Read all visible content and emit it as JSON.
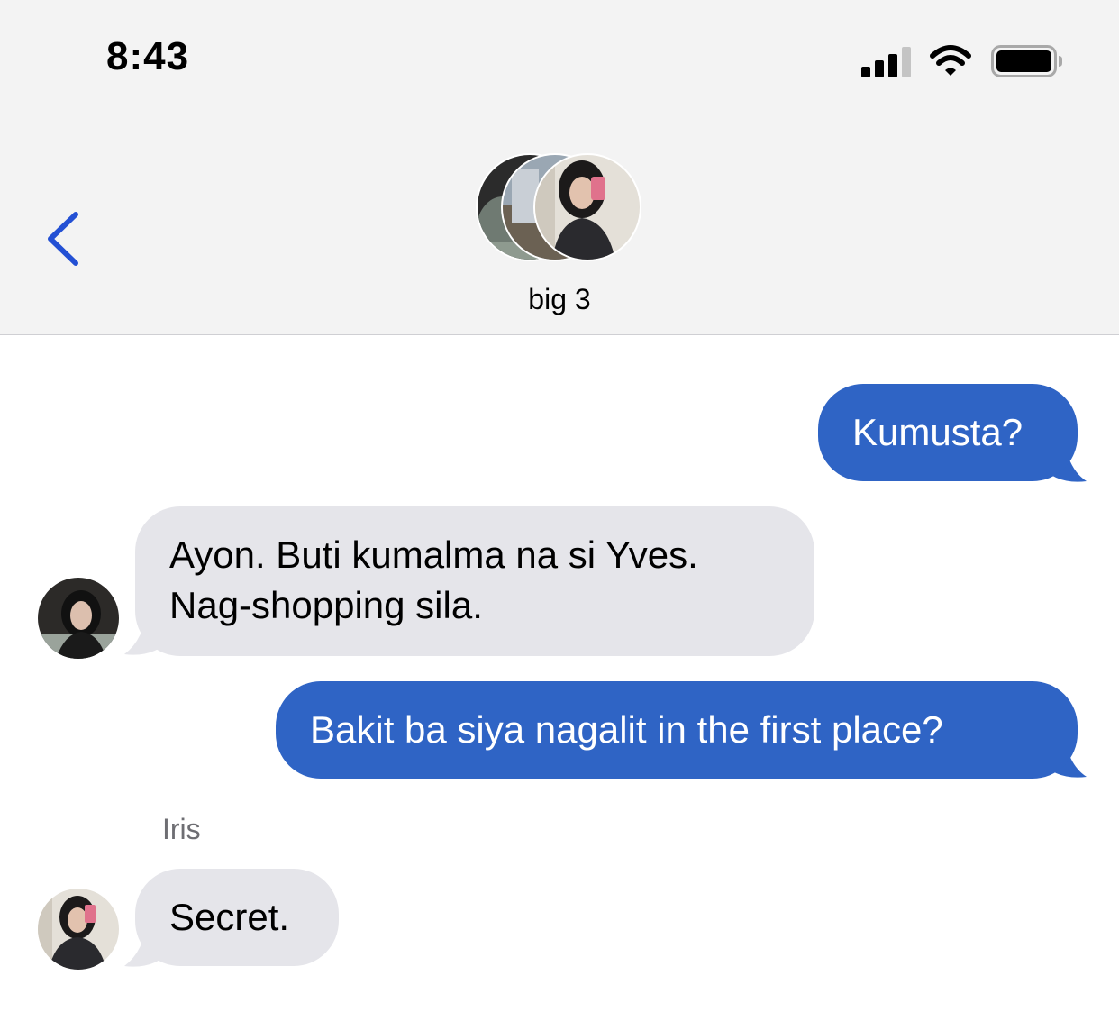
{
  "status_bar": {
    "time": "8:43",
    "icons": [
      "cellular-signal-icon",
      "wifi-icon",
      "battery-icon"
    ]
  },
  "header": {
    "back_icon": "chevron-left-icon",
    "group_name": "big 3",
    "avatar_count": 3
  },
  "conversation": {
    "messages": [
      {
        "direction": "outgoing",
        "text": "Kumusta?"
      },
      {
        "direction": "incoming",
        "lines": [
          "Ayon. Buti kumalma na si Yves.",
          "Nag-shopping sila."
        ]
      },
      {
        "direction": "outgoing",
        "text": "Bakit ba siya nagalit in the first place?"
      },
      {
        "direction": "incoming",
        "sender": "Iris",
        "text": "Secret."
      }
    ]
  },
  "colors": {
    "outgoing_bubble": "#2f64c5",
    "incoming_bubble": "#e5e5ea",
    "accent": "#2350d4",
    "header_bg": "#f3f3f3"
  }
}
